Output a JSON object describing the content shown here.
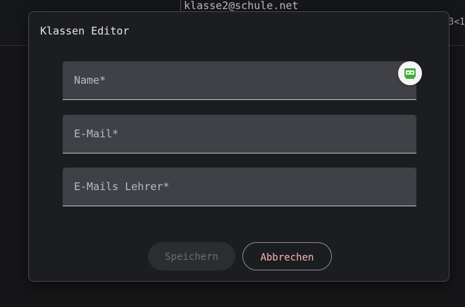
{
  "background": {
    "email": "klasse2@schule.net",
    "cut_text": "3<1"
  },
  "dialog": {
    "title": "Klassen Editor",
    "fields": [
      {
        "label": "Name*",
        "value": ""
      },
      {
        "label": "E-Mail*",
        "value": ""
      },
      {
        "label": "E-Mails Lehrer*",
        "value": ""
      }
    ],
    "buttons": {
      "save_label": "Speichern",
      "cancel_label": "Abbrechen"
    },
    "extension_icon": "password-manager-icon"
  },
  "colors": {
    "surface": "#1c1d20",
    "field_fill": "#3f4146",
    "cancel_text": "#f2b8b2",
    "disabled_text": "#6c6e72",
    "extension_green": "#3fae3a"
  }
}
